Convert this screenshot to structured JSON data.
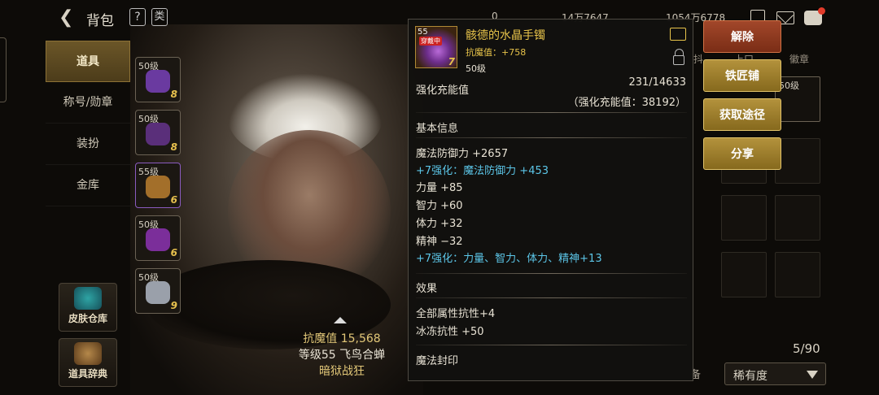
{
  "topbar": {
    "title": "背包",
    "help_glyph": "?",
    "key_glyph": "类",
    "currencies": [
      "0",
      "14万7647",
      "1054万6778"
    ]
  },
  "nav": {
    "items": [
      "道具",
      "称号/勋章",
      "装扮",
      "金库"
    ],
    "active": 0
  },
  "side_buttons": [
    "皮肤仓库",
    "道具辞典"
  ],
  "slots": [
    {
      "level": "50级",
      "count": "8",
      "color": "#6a3aa0"
    },
    {
      "level": "50级",
      "count": "8",
      "color": "#5a2f7a"
    },
    {
      "level": "55级",
      "count": "6",
      "color": "#a36f2a"
    },
    {
      "level": "50级",
      "count": "6",
      "color": "#7b2e9a"
    },
    {
      "level": "50级",
      "count": "9",
      "color": "#9aa0aa"
    }
  ],
  "character": {
    "magic_resist": "抗魔值 15,568",
    "level_title": "等级55 飞鸟合蝉",
    "job": "暗狱战狂"
  },
  "tooltip": {
    "icon_level": "55",
    "icon_tag": "穿戴中",
    "icon_count": "7",
    "name": "骸德的水晶手镯",
    "magic_resist": "抗魔值：+758",
    "level": "50级",
    "enhance_label": "强化充能值",
    "enhance_value": "231/14633",
    "enhance_total": "（强化充能值：38192）",
    "basic_title": "基本信息",
    "stats": [
      {
        "text": "魔法防御力 +2657",
        "blue": false
      },
      {
        "text": "+7强化：魔法防御力 +453",
        "blue": true
      },
      {
        "text": "力量 +85",
        "blue": false
      },
      {
        "text": "智力 +60",
        "blue": false
      },
      {
        "text": "体力 +32",
        "blue": false
      },
      {
        "text": "精神 −32",
        "blue": false
      },
      {
        "text": "+7强化：力量、智力、体力、精神+13",
        "blue": true
      }
    ],
    "effect_title": "效果",
    "effects": [
      "全部属性抗性+4",
      "冰冻抗性 +50"
    ],
    "seal_title": "魔法封印"
  },
  "actions": [
    "解除",
    "铁匠铺",
    "获取途径",
    "分享"
  ],
  "right_panel": {
    "tabs": [
      "抖",
      "上口",
      "徽章"
    ],
    "slot_level": "50级",
    "count": "5/90",
    "equip_label": "备",
    "sort_label": "稀有度"
  }
}
